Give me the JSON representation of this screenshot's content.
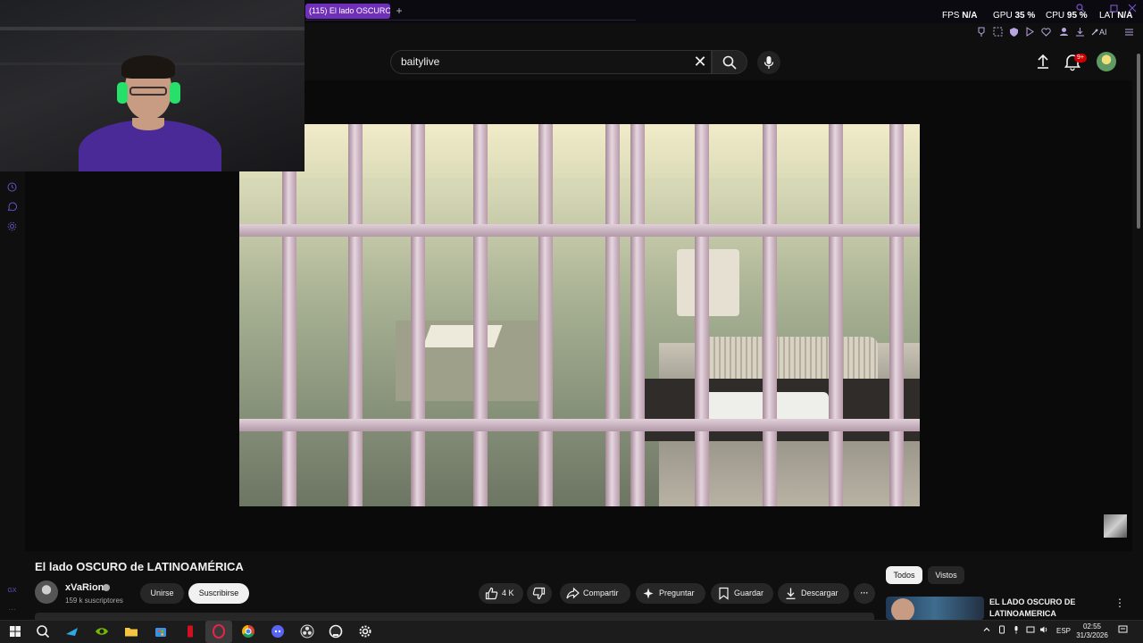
{
  "browser": {
    "tab_title": "(115) El lado OSCURO",
    "new_tab_symbol": "+",
    "ai_label": "AI"
  },
  "hud": {
    "fps_label": "FPS",
    "fps_value": "N/A",
    "gpu_label": "GPU",
    "gpu_value": "35 %",
    "cpu_label": "CPU",
    "cpu_value": "95 %",
    "lat_label": "LAT",
    "lat_value": "N/A"
  },
  "search": {
    "query": "baitylive",
    "clear_symbol": "✕"
  },
  "header": {
    "notification_count": "9+"
  },
  "sidebar": {
    "bottom_label_1": "GX",
    "bottom_label_2": "···"
  },
  "video": {
    "title": "El lado OSCURO de LATINOAMÉRICA"
  },
  "channel": {
    "name": "xVaRion",
    "subscribers": "159 k suscriptores",
    "join_label": "Unirse",
    "subscribe_label": "Suscribirse"
  },
  "actions": {
    "like_count": "4 K",
    "share_label": "Compartir",
    "ask_label": "Preguntar",
    "save_label": "Guardar",
    "download_label": "Descargar",
    "more_symbol": "···"
  },
  "filters": {
    "all_label": "Todos",
    "watched_label": "Vistos"
  },
  "recommendation": {
    "title": "EL LADO OSCURO DE LATINOAMERICA",
    "more_symbol": "⋮"
  },
  "taskbar": {
    "language": "ESP",
    "time": "02:55",
    "date": "31/3/2026"
  },
  "colors": {
    "opera_accent": "#6f2fb8",
    "youtube_bg": "#0f0f0f",
    "notification_red": "#cc0000"
  }
}
